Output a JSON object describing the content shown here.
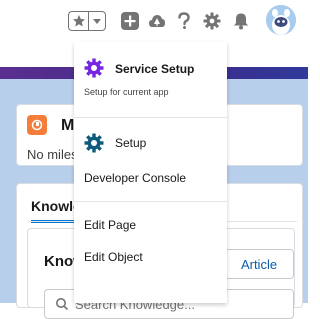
{
  "header": {
    "favorites_star_icon": "star-icon",
    "favorites_menu_icon": "chevron-down-icon",
    "global_actions_icon": "plus-icon",
    "trailhead_icon": "trailhead-icon",
    "help_icon": "question-icon",
    "setup_icon": "gear-icon",
    "notifications_icon": "bell-icon",
    "avatar_icon": "astro-avatar-icon"
  },
  "background": {
    "card1": {
      "title": "M",
      "text": "No milestones"
    },
    "card2": {
      "tab": "Knowledge",
      "inner_title": "Knowledge",
      "new_button": "Article",
      "search_placeholder": "Search Knowledge..."
    }
  },
  "setup_menu": {
    "items": [
      {
        "label": "Service Setup",
        "subtitle": "Setup for current app",
        "icon": "service-setup-gear-icon"
      },
      {
        "label": "Setup",
        "icon": "setup-gear-icon"
      },
      {
        "label": "Developer Console"
      },
      {
        "label": "Edit Page"
      },
      {
        "label": "Edit Object"
      }
    ]
  },
  "colors": {
    "service_setup_icon": "#7526e3",
    "setup_icon": "#0d5b7d",
    "header_icons": "#747474",
    "app_bar": "#4a2d8f",
    "brand_blue": "#0176d3"
  }
}
